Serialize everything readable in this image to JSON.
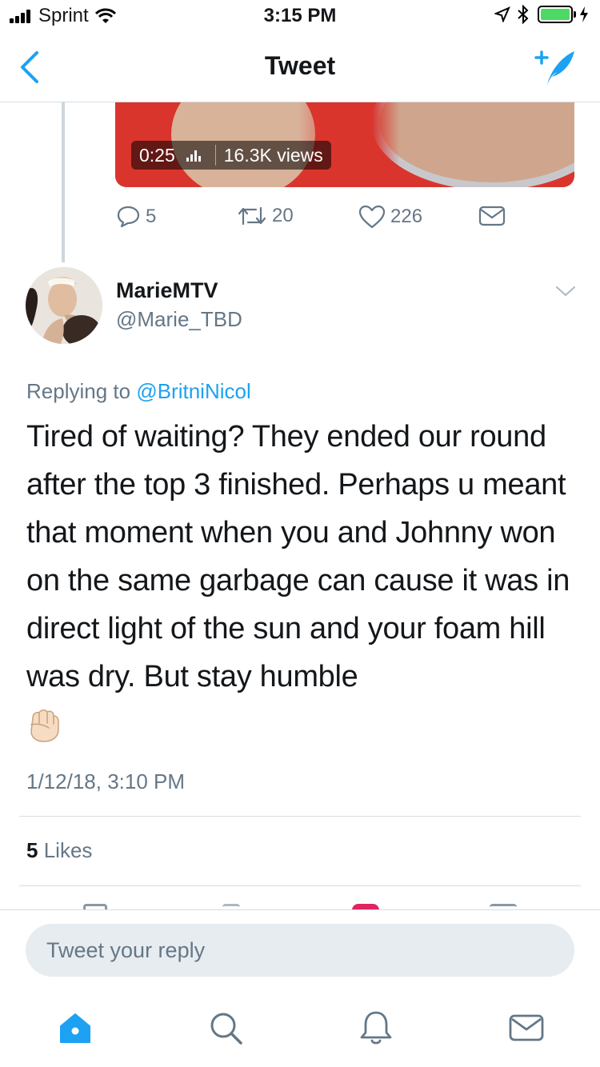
{
  "status_bar": {
    "carrier": "Sprint",
    "time": "3:15 PM",
    "battery_color": "#4cd964"
  },
  "navbar": {
    "title": "Tweet",
    "back_icon": "chevron-left-icon",
    "compose_icon": "compose-tweet-icon"
  },
  "parent_tweet": {
    "video": {
      "duration": "0:25",
      "views": "16.3K views"
    },
    "actions": {
      "replies": "5",
      "retweets": "20",
      "likes": "226"
    }
  },
  "tweet": {
    "author_name": "MarieMTV",
    "author_handle": "@Marie_TBD",
    "replying_prefix": "Replying to",
    "replying_to": "@BritniNicol",
    "text": "Tired of waiting? They ended our round after the top 3 finished. Perhaps u meant that moment when you and Johnny won on the same garbage can cause it was in direct light of the sun and your foam hill was dry. But stay humble",
    "emoji": "raised-fist",
    "timestamp": "1/12/18, 3:10 PM",
    "likes_count": "5",
    "likes_label": "Likes"
  },
  "reply": {
    "placeholder": "Tweet your reply"
  },
  "tabbar": {
    "items": [
      "home-icon",
      "search-icon",
      "notifications-icon",
      "messages-icon"
    ],
    "accent": "#1da1f2"
  }
}
